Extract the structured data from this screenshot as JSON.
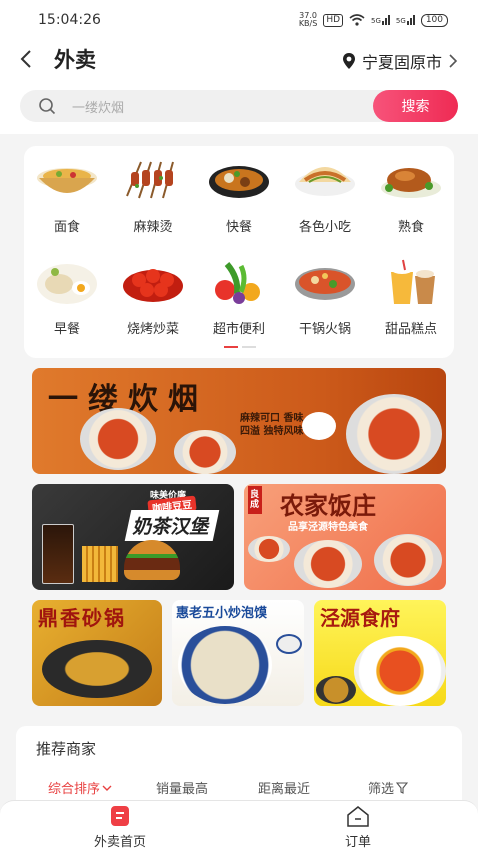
{
  "status": {
    "time": "15:04:26",
    "net_speed": "37.0\nKB/S",
    "hd": "HD",
    "signal1": "5G",
    "signal2": "5G",
    "battery": "100"
  },
  "header": {
    "title": "外卖",
    "city": "宁夏固原市"
  },
  "search": {
    "placeholder": "一缕炊烟",
    "button": "搜索"
  },
  "categories": [
    {
      "label": "面食",
      "icon": "noodles-icon"
    },
    {
      "label": "麻辣烫",
      "icon": "skewers-icon"
    },
    {
      "label": "快餐",
      "icon": "fastfood-icon"
    },
    {
      "label": "各色小吃",
      "icon": "snack-icon"
    },
    {
      "label": "熟食",
      "icon": "roast-icon"
    },
    {
      "label": "早餐",
      "icon": "breakfast-icon"
    },
    {
      "label": "烧烤炒菜",
      "icon": "crayfish-icon"
    },
    {
      "label": "超市便利",
      "icon": "vegetables-icon"
    },
    {
      "label": "干锅火锅",
      "icon": "hotpot-icon"
    },
    {
      "label": "甜品糕点",
      "icon": "dessert-icon"
    }
  ],
  "banners": {
    "b1_title": "一缕炊烟",
    "b1_sub": "麻辣可口 香味四溢 独特风味",
    "b2_small": "味美价廉",
    "b2_tag": "咖啡豆豆",
    "b2_title": "奶茶汉堡",
    "b3_stamp": "良成",
    "b3_title": "农家饭庄",
    "b3_sub": "品享泾源特色美食",
    "b4_title": "鼎香砂锅",
    "b5_title": "惠老五小炒泡馍",
    "b6_title": "泾源食府"
  },
  "recommend": {
    "title": "推荐商家",
    "sorts": [
      "综合排序",
      "销量最高",
      "距离最近",
      "筛选"
    ]
  },
  "tabbar": {
    "home": "外卖首页",
    "orders": "订单"
  },
  "colors": {
    "accent": "#e84040",
    "search_button": "#ef2b54"
  }
}
